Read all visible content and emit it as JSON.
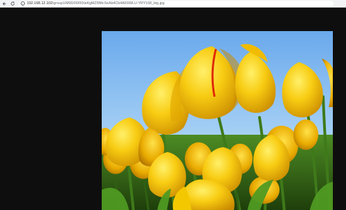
{
  "browser": {
    "url_host": "192.168.12.102",
    "url_path": "/group1/M00/00/00/wKgMZl9McSeAb4Cb4A6SWLU-YRY168_big.jpg"
  },
  "image": {
    "subject": "yellow-tulips-photo"
  },
  "colors": {
    "page_background": "#0e0e0e",
    "toolbar_background": "#f1f3f4",
    "sky": "#6fb0ee",
    "tulip": "#f5c400",
    "stem": "#3f7a1a"
  }
}
